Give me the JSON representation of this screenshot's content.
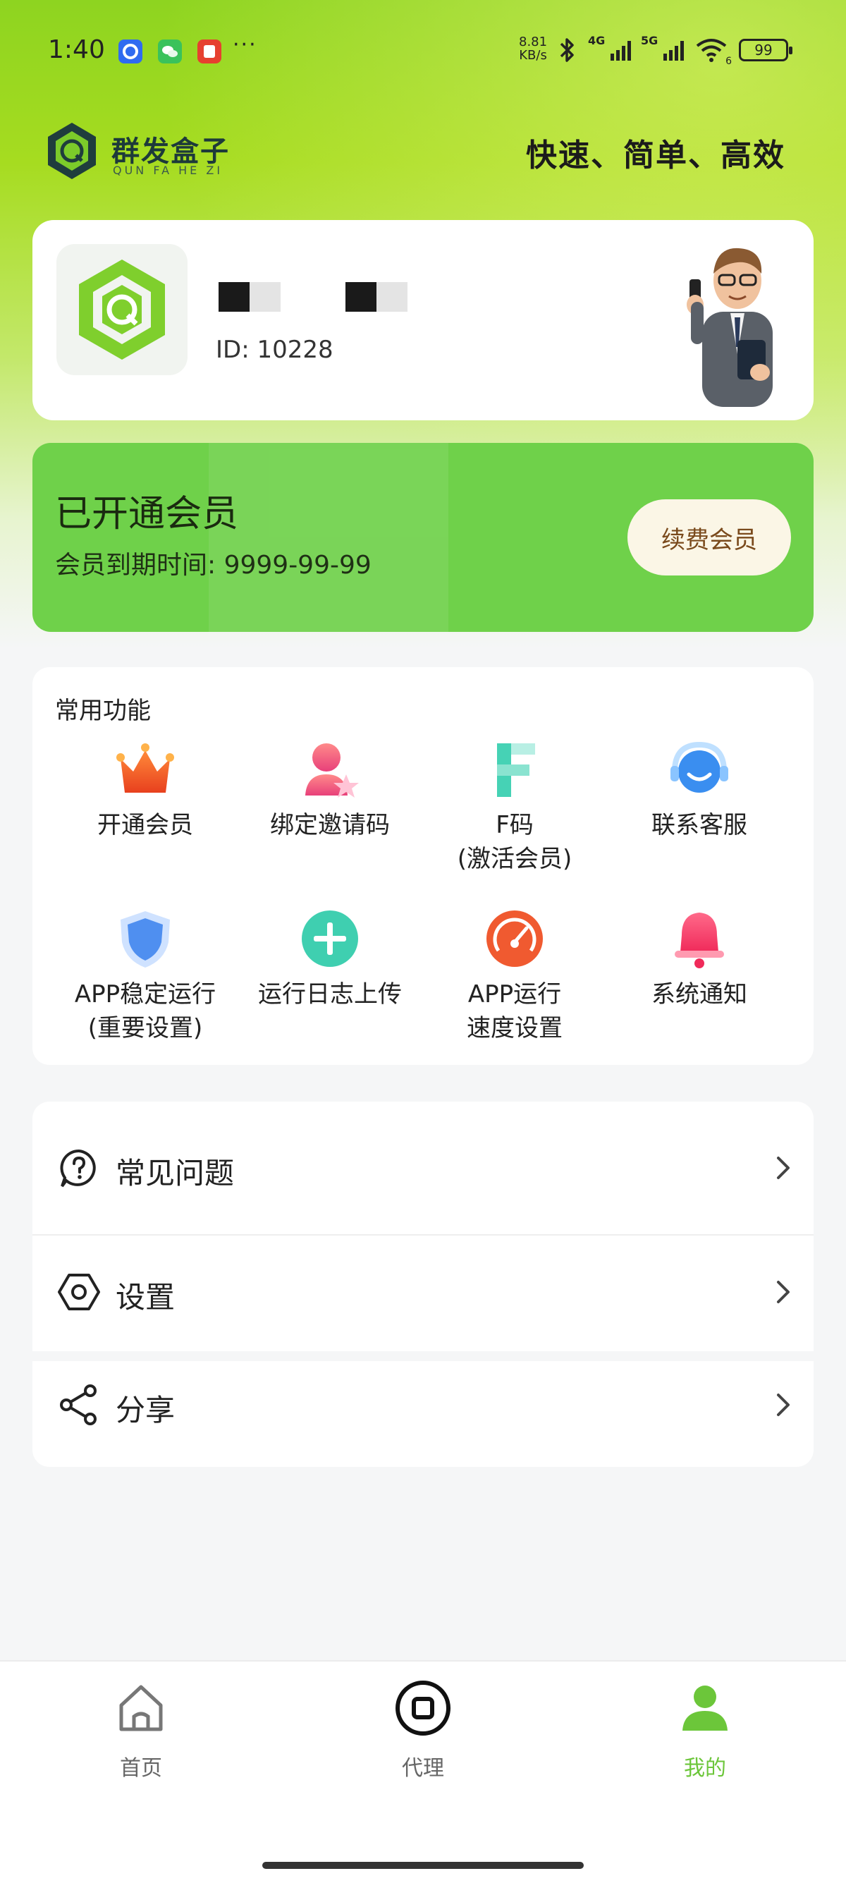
{
  "status_bar": {
    "time": "1:40",
    "dots": "···",
    "net_speed_value": "8.81",
    "net_speed_unit": "KB/s",
    "signal1_label": "4G",
    "signal2_label": "5G",
    "battery": "99",
    "wifi_sub": "6"
  },
  "header": {
    "logo_title": "群发盒子",
    "logo_sub": "QUN FA HE ZI",
    "slogan": "快速、简单、高效"
  },
  "profile": {
    "id_text": "ID: 10228"
  },
  "vip": {
    "title": "已开通会员",
    "expire": "会员到期时间: 9999-99-99",
    "renew_label": "续费会员"
  },
  "functions": {
    "title": "常用功能",
    "items": [
      {
        "label": "开通会员",
        "icon": "crown-icon"
      },
      {
        "label": "绑定邀请码",
        "icon": "user-star-icon"
      },
      {
        "label": "F码\n(激活会员)",
        "icon": "f-code-icon"
      },
      {
        "label": "联系客服",
        "icon": "customer-service-icon"
      },
      {
        "label": "APP稳定运行\n(重要设置)",
        "icon": "shield-icon"
      },
      {
        "label": "运行日志上传",
        "icon": "plus-circle-icon"
      },
      {
        "label": "APP运行\n速度设置",
        "icon": "speedometer-icon"
      },
      {
        "label": "系统通知",
        "icon": "bell-icon"
      }
    ]
  },
  "menu": {
    "items": [
      {
        "label": "常见问题",
        "icon": "question-icon"
      },
      {
        "label": "设置",
        "icon": "hexagon-settings-icon"
      },
      {
        "label": "分享",
        "icon": "share-icon"
      }
    ]
  },
  "bottom_nav": {
    "items": [
      {
        "label": "首页",
        "icon": "home-icon",
        "active": false
      },
      {
        "label": "代理",
        "icon": "agent-icon",
        "active": false
      },
      {
        "label": "我的",
        "icon": "profile-icon",
        "active": true
      }
    ],
    "active_color": "#6cc63a"
  },
  "colors": {
    "accent_green": "#6fd14a",
    "header_green": "#9ad820",
    "renew_bg": "#fbf6e6"
  }
}
